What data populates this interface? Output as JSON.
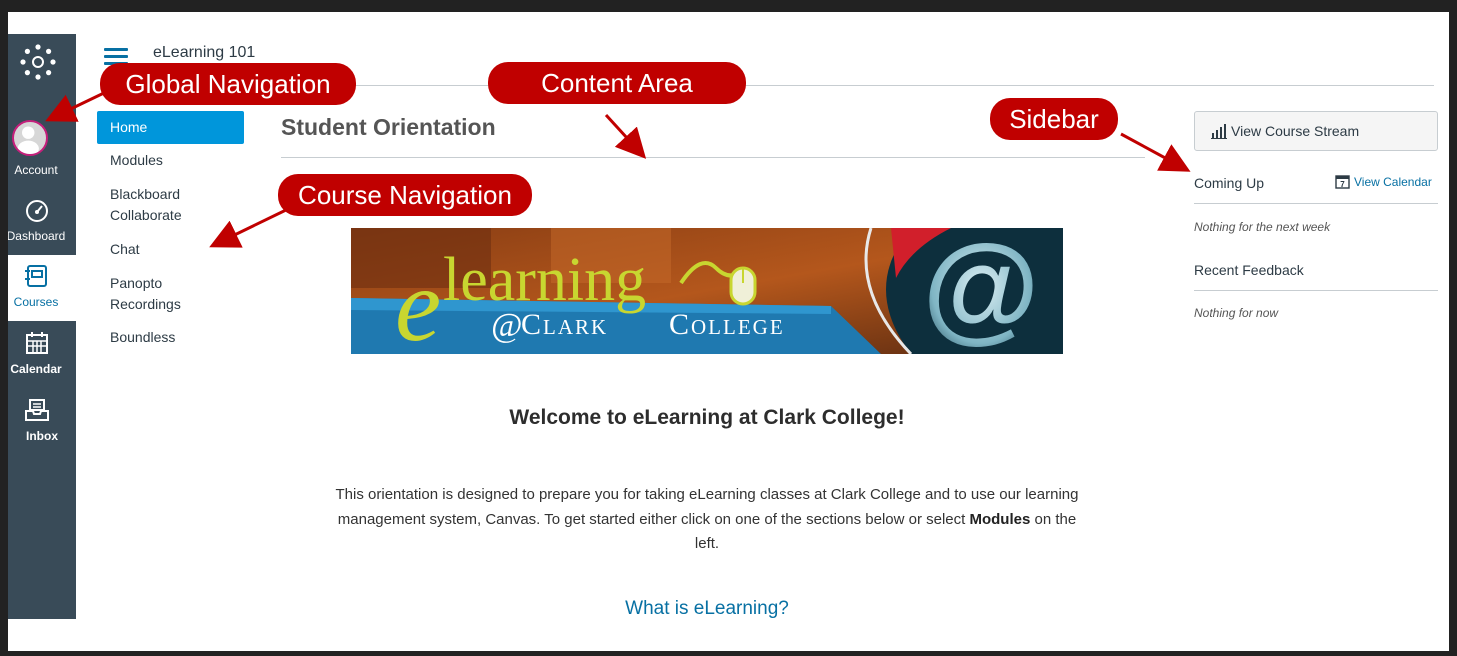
{
  "header": {
    "course_title": "eLearning 101"
  },
  "global_nav": {
    "items": [
      {
        "label": "Account",
        "icon": "avatar-icon"
      },
      {
        "label": "Dashboard",
        "icon": "dashboard-icon"
      },
      {
        "label": "Courses",
        "icon": "courses-icon",
        "active": true
      },
      {
        "label": "Calendar",
        "icon": "calendar-icon"
      },
      {
        "label": "Inbox",
        "icon": "inbox-icon"
      }
    ]
  },
  "course_nav": {
    "items": [
      {
        "label": "Home",
        "active": true
      },
      {
        "label": "Modules"
      },
      {
        "label": "Blackboard Collaborate"
      },
      {
        "label": "Chat"
      },
      {
        "label": "Panopto Recordings"
      },
      {
        "label": "Boundless"
      }
    ]
  },
  "content": {
    "page_heading": "Student Orientation",
    "banner": {
      "word": "learning",
      "e": "e",
      "at": "@",
      "clark": "Clark",
      "college": "College"
    },
    "welcome": "Welcome to eLearning at Clark College!",
    "intro_before": "This orientation is designed to prepare you for taking eLearning classes at Clark College and to use our learning management system, Canvas. To get started either click on one of the sections below or select",
    "intro_bold": "Modules",
    "intro_after": "on the left.",
    "link_text": "What is eLearning?"
  },
  "sidebar": {
    "stream_button": "View Course Stream",
    "coming_up": "Coming Up",
    "view_calendar": "View Calendar",
    "calendar_day": "7",
    "coming_up_empty": "Nothing for the next week",
    "recent_feedback": "Recent Feedback",
    "recent_feedback_empty": "Nothing for now"
  },
  "callouts": {
    "global_navigation": "Global Navigation",
    "content_area": "Content Area",
    "sidebar": "Sidebar",
    "course_navigation": "Course Navigation"
  },
  "colors": {
    "global_nav_bg": "#394b58",
    "active_blue": "#0096db",
    "link_blue": "#0770a3",
    "callout_red": "#c00000",
    "avatar_ring": "#c51f7b"
  }
}
